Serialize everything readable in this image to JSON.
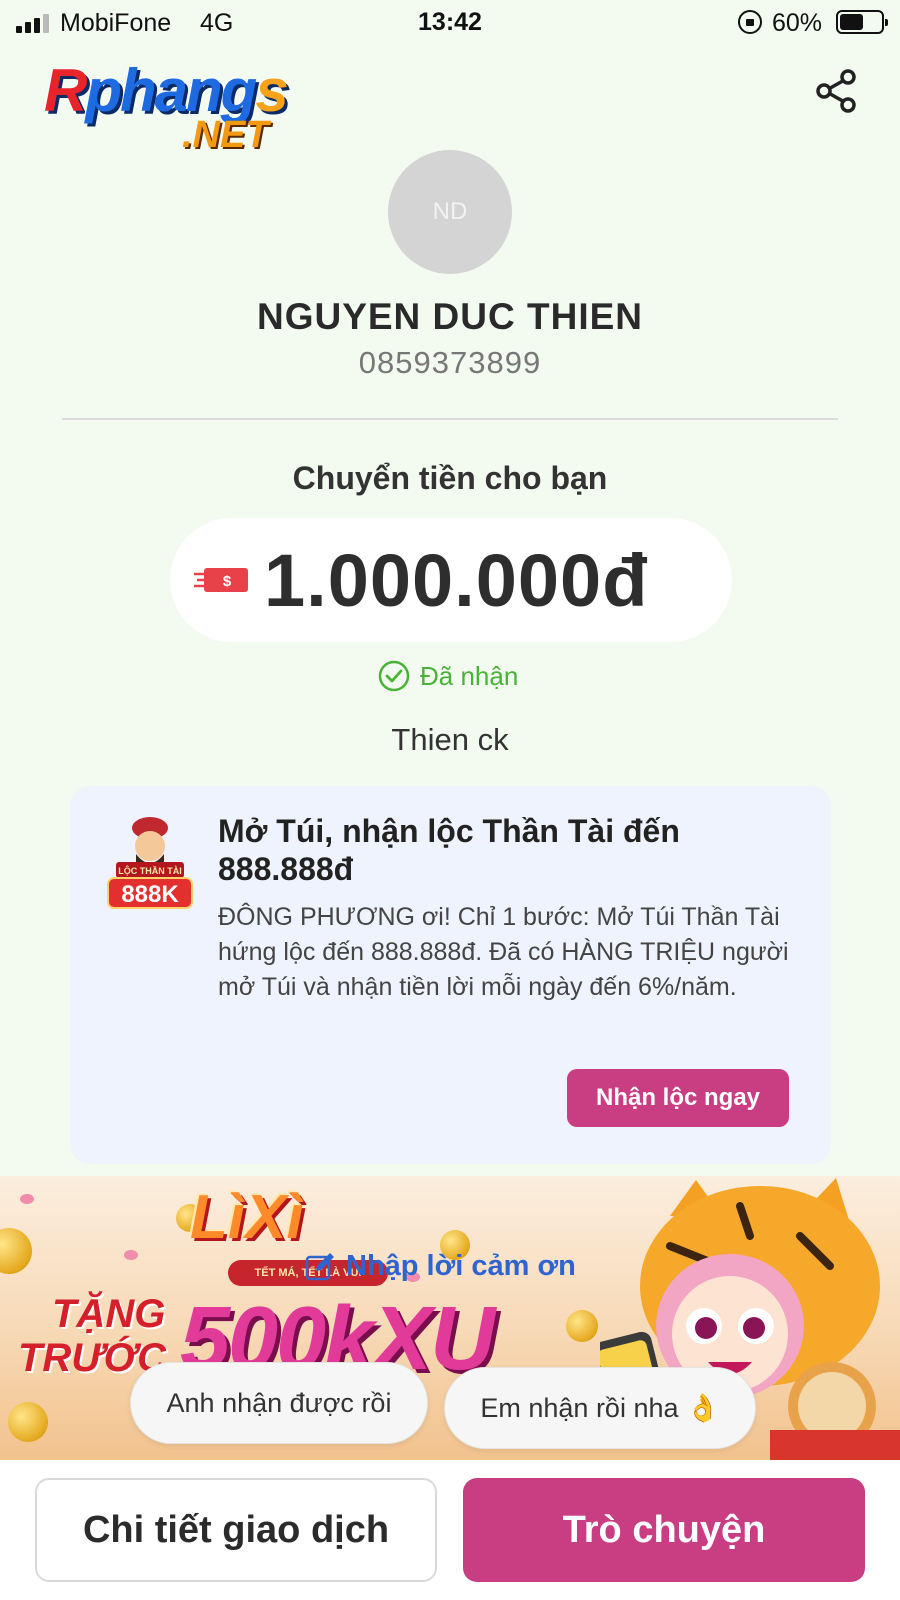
{
  "status_bar": {
    "carrier": "MobiFone",
    "network": "4G",
    "time": "13:42",
    "battery": "60%"
  },
  "logo": {
    "text_main_r": "R",
    "text_main": "phang",
    "text_main_s": "s",
    "text_sub": ".NET"
  },
  "recipient": {
    "initials": "ND",
    "name": "NGUYEN DUC THIEN",
    "phone": "0859373899"
  },
  "transfer": {
    "label": "Chuyển tiền cho bạn",
    "amount": "1.000.000đ",
    "status": "Đã nhận",
    "note": "Thien ck"
  },
  "promo": {
    "badge_caption": "LỘC THẦN TÀI",
    "badge_amount": "888K",
    "title": "Mở Túi, nhận lộc Thần Tài đến 888.888đ",
    "description": "ĐÔNG PHƯƠNG ơi! Chỉ 1 bước: Mở Túi Thần Tài hứng lộc đến 888.888đ. Đã có HÀNG TRIỆU người mở Túi và nhận tiền lời mỗi ngày đến 6%/năm.",
    "button": "Nhận lộc ngay"
  },
  "banner": {
    "title": "LìXì",
    "slogan": "TẾT MÁ, TẾT LÀ VUI",
    "line1": "TẶNG",
    "line2": "TRƯỚC",
    "amount": "500kXU"
  },
  "thanks_link": "Nhập lời cảm ơn",
  "quick_replies": [
    "Anh nhận được rồi",
    "Em nhận rồi nha 👌"
  ],
  "actions": {
    "detail": "Chi tiết giao dịch",
    "chat": "Trò chuyện"
  },
  "colors": {
    "accent": "#c93d83",
    "success": "#4ab236",
    "link": "#2f63d0",
    "background": "#f3fbf1"
  }
}
